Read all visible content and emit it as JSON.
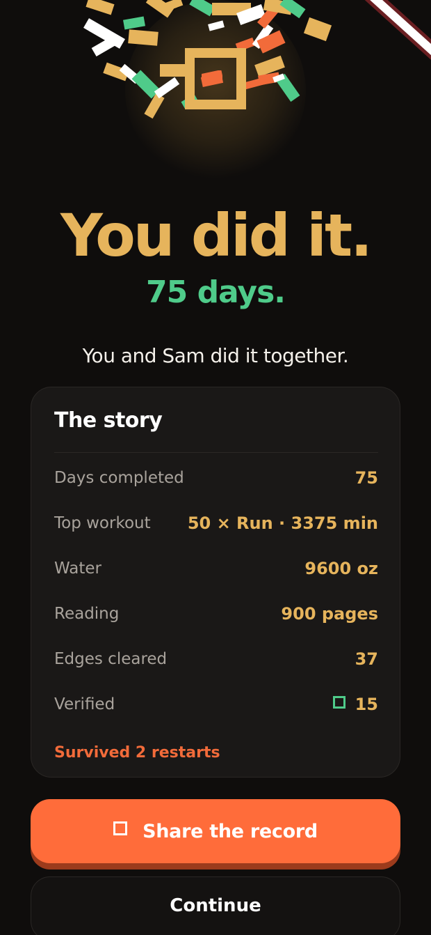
{
  "colors": {
    "background": "#0f0d0c",
    "accent_gold": "#e6b45c",
    "accent_green": "#4fcb8a",
    "accent_orange": "#ff6c3a",
    "restart_red": "#f26b3a",
    "card_bg": "#1a1817",
    "muted_label": "#a9a39c"
  },
  "hero": {
    "logo_icon": "brand-square-icon",
    "headline": "You did it.",
    "subheadline": "75 days.",
    "together_text": "You and Sam did it together."
  },
  "story": {
    "title": "The story",
    "stats": [
      {
        "label": "Days completed",
        "value": "75"
      },
      {
        "label": "Top workout",
        "value": "50 × Run · 3375 min"
      },
      {
        "label": "Water",
        "value": "9600 oz"
      },
      {
        "label": "Reading",
        "value": "900 pages"
      },
      {
        "label": "Edges cleared",
        "value": "37"
      },
      {
        "label": "Verified",
        "value": "15",
        "icon": "verified-square-icon"
      }
    ],
    "restarts_note": "Survived 2 restarts"
  },
  "actions": {
    "share_label": "Share the record",
    "share_icon": "share-square-icon",
    "continue_label": "Continue"
  }
}
